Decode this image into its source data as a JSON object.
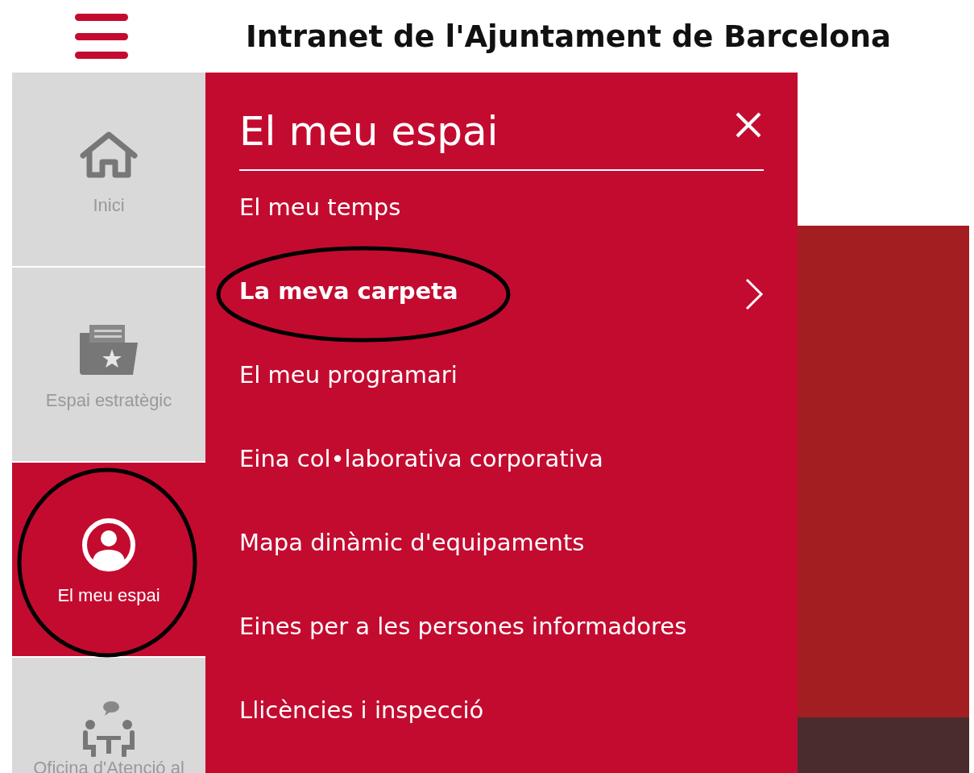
{
  "header": {
    "title": "Intranet de l'Ajuntament de Barcelona"
  },
  "sidebar": {
    "items": [
      {
        "kind": "home",
        "label": "Inici",
        "selected": false,
        "circled": false
      },
      {
        "kind": "folder",
        "label": "Espai estratègic",
        "selected": false,
        "circled": false
      },
      {
        "kind": "user",
        "label": "El meu espai",
        "selected": true,
        "circled": true
      },
      {
        "kind": "meeting",
        "label": "Oficina d'Atenció al",
        "selected": false,
        "circled": false
      }
    ]
  },
  "menu": {
    "title": "El meu espai",
    "items": [
      {
        "label": "El meu temps",
        "selected": false,
        "circled": false
      },
      {
        "label": "La meva carpeta",
        "selected": true,
        "circled": true
      },
      {
        "label": "El meu programari",
        "selected": false,
        "circled": false
      },
      {
        "label": "Eina col•laborativa corporativa",
        "selected": false,
        "circled": false
      },
      {
        "label": "Mapa dinàmic d'equipaments",
        "selected": false,
        "circled": false
      },
      {
        "label": "Eines per a les persones informadores",
        "selected": false,
        "circled": false
      },
      {
        "label": "Llicències i inspecció",
        "selected": false,
        "circled": false
      }
    ]
  }
}
